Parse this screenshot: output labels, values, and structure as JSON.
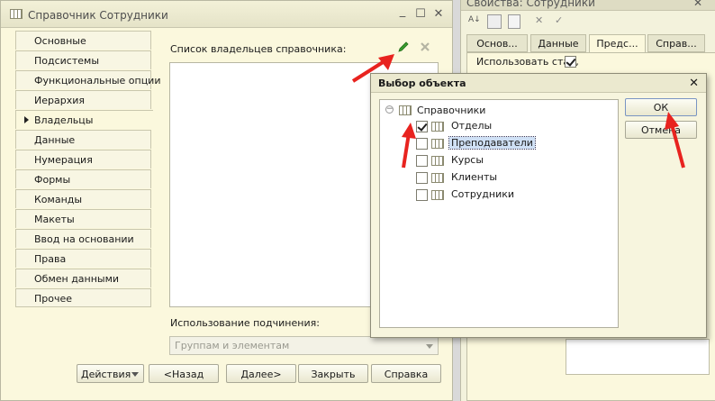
{
  "main_window": {
    "title": "Справочник Сотрудники",
    "minimize_glyph": "_",
    "maximize_glyph": "☐",
    "close_glyph": "✕"
  },
  "tabs": [
    {
      "label": "Основные",
      "active": false
    },
    {
      "label": "Подсистемы",
      "active": false
    },
    {
      "label": "Функциональные опции",
      "active": false
    },
    {
      "label": "Иерархия",
      "active": false
    },
    {
      "label": "Владельцы",
      "active": true
    },
    {
      "label": "Данные",
      "active": false
    },
    {
      "label": "Нумерация",
      "active": false
    },
    {
      "label": "Формы",
      "active": false
    },
    {
      "label": "Команды",
      "active": false
    },
    {
      "label": "Макеты",
      "active": false
    },
    {
      "label": "Ввод на основании",
      "active": false
    },
    {
      "label": "Права",
      "active": false
    },
    {
      "label": "Обмен данными",
      "active": false
    },
    {
      "label": "Прочее",
      "active": false
    }
  ],
  "owners": {
    "list_label": "Список владельцев справочника:",
    "subordination_label": "Использование подчинения:",
    "subordination_value": "Группам и элементам"
  },
  "bottom_buttons": {
    "actions": "Действия",
    "back": "<Назад",
    "next": "Далее>",
    "close": "Закрыть",
    "help": "Справка"
  },
  "properties_panel": {
    "title": "Свойства: Сотрудники",
    "tabs": [
      "Основ...",
      "Данные",
      "Предс...",
      "Справ..."
    ],
    "option_label": "Использовать стан,",
    "option_checked": true
  },
  "dialog": {
    "title": "Выбор объекта",
    "close_glyph": "✕",
    "root": "Справочники",
    "items": [
      {
        "label": "Отделы",
        "checked": true,
        "selected": false
      },
      {
        "label": "Преподаватели",
        "checked": false,
        "selected": true
      },
      {
        "label": "Курсы",
        "checked": false,
        "selected": false
      },
      {
        "label": "Клиенты",
        "checked": false,
        "selected": false
      },
      {
        "label": "Сотрудники",
        "checked": false,
        "selected": false
      }
    ],
    "ok": "ОК",
    "cancel": "Отмена"
  },
  "colors": {
    "window_bg": "#fbf8dd",
    "accent_arrow": "#e8231f",
    "selection": "#cfe0f5",
    "edit_icon": "#3a9d2e"
  },
  "icons": [
    "catalog-icon",
    "pencil-icon",
    "delete-icon",
    "tab-arrow-icon",
    "dropdown-arrow-icon",
    "collapse-icon",
    "close-icon"
  ]
}
